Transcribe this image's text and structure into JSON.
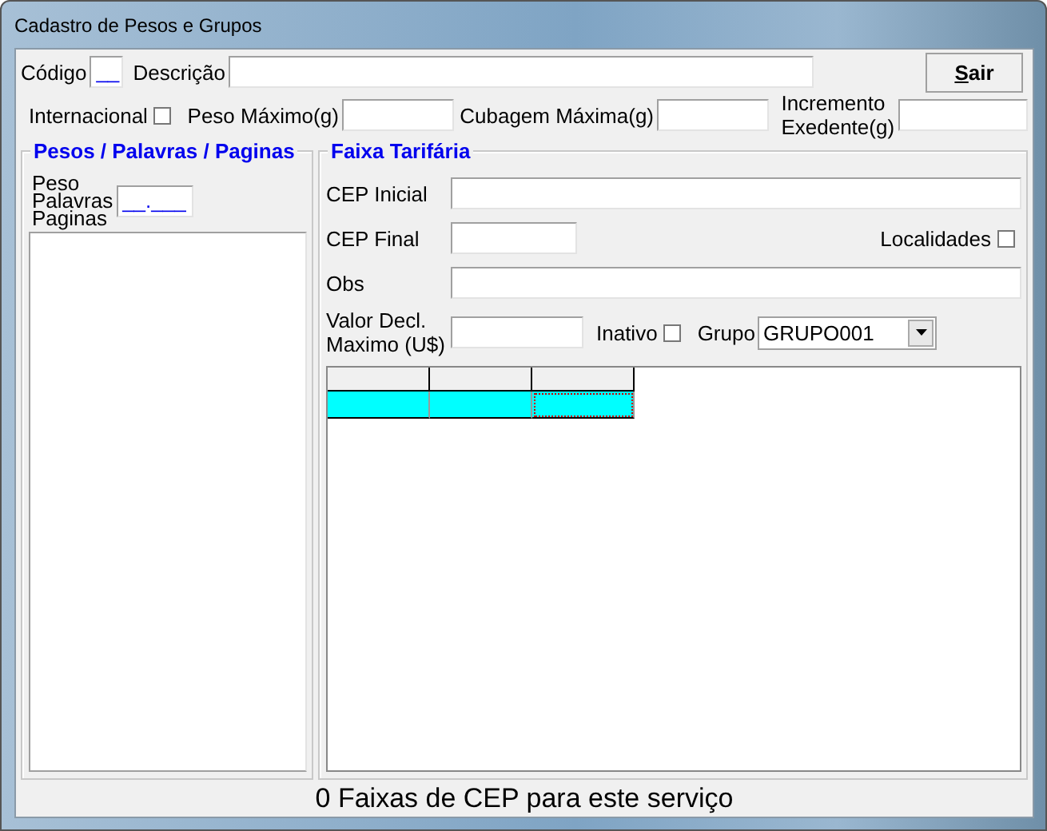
{
  "window": {
    "title": "Cadastro de Pesos e Grupos"
  },
  "header": {
    "codigo_label": "Código",
    "codigo_value": "__",
    "descricao_label": "Descrição",
    "exit_button": "Sair"
  },
  "limits": {
    "internacional_label": "Internacional",
    "internacional_checked": false,
    "peso_label": "Peso Máximo(g)",
    "cubagem_label": "Cubagem Máxima(g)",
    "incremento_label": [
      "Incremento",
      "Exedente(g)"
    ]
  },
  "left_group": {
    "title": "Pesos / Palavras / Paginas",
    "labels": [
      "Peso",
      "Palavras",
      "Paginas"
    ],
    "value": "__.___"
  },
  "right_group": {
    "title": "Faixa Tarifária",
    "cep_inicial_label": "CEP Inicial",
    "cep_final_label": "CEP Final",
    "localidades_label": "Localidades",
    "localidades_checked": false,
    "obs_label": "Obs",
    "valor_label": [
      "Valor Decl.",
      "Maximo (U$)"
    ],
    "inativo_label": "Inativo",
    "inativo_checked": false,
    "grupo_label": "Grupo",
    "grupo_value": "GRUPO001"
  },
  "grid": {
    "rows": [
      {
        "selected": true
      }
    ]
  },
  "status": "0 Faixas de CEP para este serviço"
}
